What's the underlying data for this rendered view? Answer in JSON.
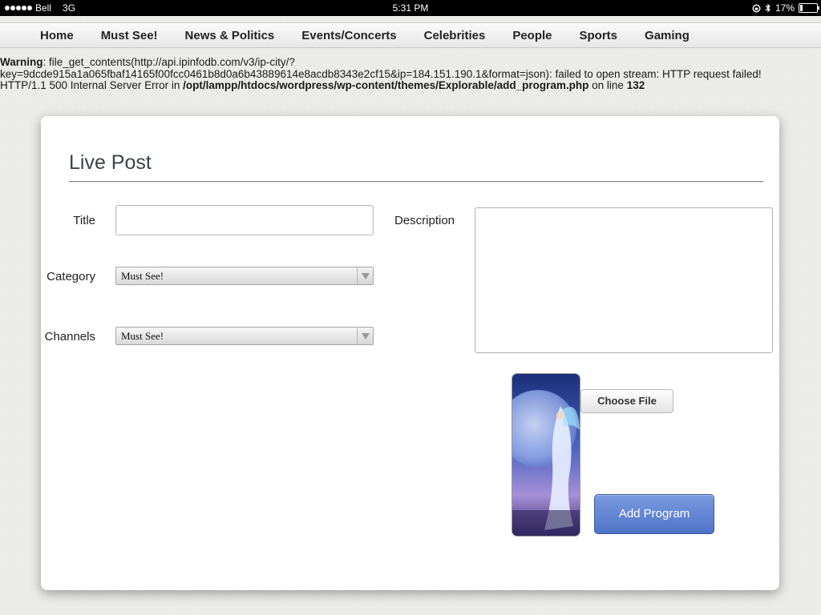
{
  "status_bar": {
    "carrier": "Bell",
    "network": "3G",
    "time": "5:31 PM",
    "battery": "17%",
    "battery_level": 0.17
  },
  "nav": {
    "items": [
      "Home",
      "Must See!",
      "News & Politics",
      "Events/Concerts",
      "Celebrities",
      "People",
      "Sports",
      "Gaming"
    ]
  },
  "warning": {
    "label": "Warning",
    "message": ": file_get_contents(http://api.ipinfodb.com/v3/ip-city/?key=9dcde915a1a065fbaf14165f00fcc0461b8d0a6b43889614e8acdb8343e2cf15&ip=184.151.190.1&format=json): failed to open stream: HTTP request failed! HTTP/1.1 500 Internal Server Error in ",
    "path": "/opt/lampp/htdocs/wordpress/wp-content/themes/Explorable/add_program.php",
    "on_line": " on line ",
    "line_number": "132"
  },
  "form": {
    "title": "Live Post",
    "title_label": "Title",
    "title_value": "",
    "category_label": "Category",
    "category_value": "Must See!",
    "channels_label": "Channels",
    "channels_value": "Must See!",
    "description_label": "Description",
    "description_value": "",
    "choose_file_label": "Choose File",
    "submit_label": "Add Program"
  },
  "colors": {
    "accent_button": "#5b7fd0",
    "title_text": "#3d4447"
  }
}
